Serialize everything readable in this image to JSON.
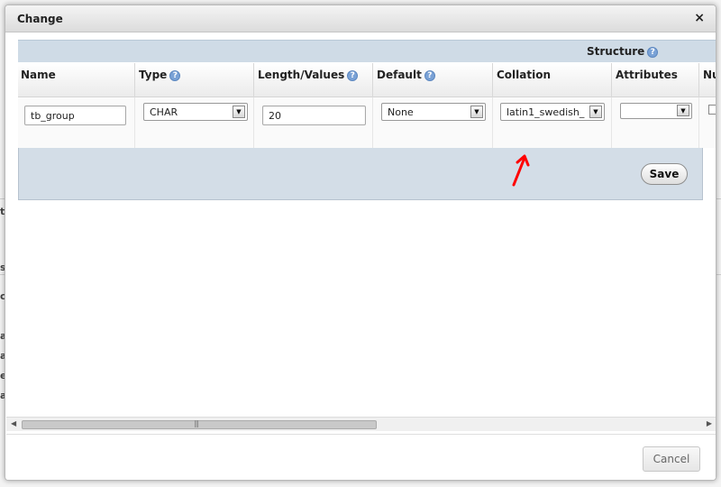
{
  "dialog": {
    "title": "Change",
    "close_label": "×"
  },
  "structure": {
    "label": "Structure"
  },
  "columns": [
    {
      "label": "Name",
      "has_help": false
    },
    {
      "label": "Type",
      "has_help": true
    },
    {
      "label": "Length/Values",
      "has_help": true
    },
    {
      "label": "Default",
      "has_help": true
    },
    {
      "label": "Collation",
      "has_help": false
    },
    {
      "label": "Attributes",
      "has_help": false
    },
    {
      "label": "Nu",
      "has_help": false
    }
  ],
  "row": {
    "name_value": "tb_group",
    "type_value": "CHAR",
    "length_value": "20",
    "default_value": "None",
    "collation_value": "latin1_swedish_",
    "attributes_value": "",
    "null_checked": false
  },
  "buttons": {
    "save": "Save",
    "cancel": "Cancel"
  },
  "background_glyphs": [
    "t",
    "s",
    "c",
    "a",
    "a",
    "e",
    "a"
  ],
  "colors": {
    "annotation_arrow": "#ff0000",
    "header_bar": "#cfdbe6",
    "save_panel": "#d3dde7"
  },
  "icons": {
    "help": "help-icon",
    "close": "close-icon",
    "dropdown": "chevron-down-icon",
    "scroll_left": "arrow-left-icon",
    "scroll_right": "arrow-right-icon"
  }
}
